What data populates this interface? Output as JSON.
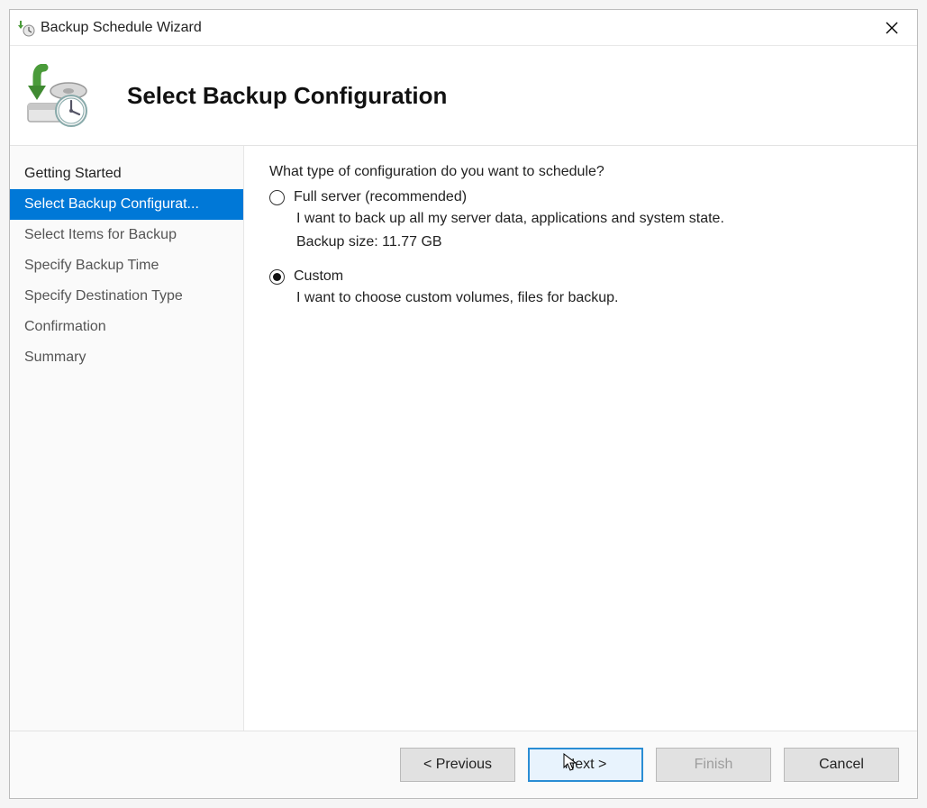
{
  "window": {
    "title": "Backup Schedule Wizard"
  },
  "header": {
    "title": "Select Backup Configuration"
  },
  "sidebar": {
    "items": [
      {
        "label": "Getting Started",
        "state": "past"
      },
      {
        "label": "Select Backup Configurat...",
        "state": "active"
      },
      {
        "label": "Select Items for Backup",
        "state": "future"
      },
      {
        "label": "Specify Backup Time",
        "state": "future"
      },
      {
        "label": "Specify Destination Type",
        "state": "future"
      },
      {
        "label": "Confirmation",
        "state": "future"
      },
      {
        "label": "Summary",
        "state": "future"
      }
    ]
  },
  "content": {
    "question": "What type of configuration do you want to schedule?",
    "options": {
      "full": {
        "label": "Full server (recommended)",
        "desc": "I want to back up all my server data, applications and system state.",
        "size": "Backup size: 11.77 GB",
        "selected": false
      },
      "custom": {
        "label": "Custom",
        "desc": "I want to choose custom volumes, files for backup.",
        "selected": true
      }
    }
  },
  "buttons": {
    "previous": "< Previous",
    "next": "Next >",
    "finish": "Finish",
    "cancel": "Cancel"
  }
}
